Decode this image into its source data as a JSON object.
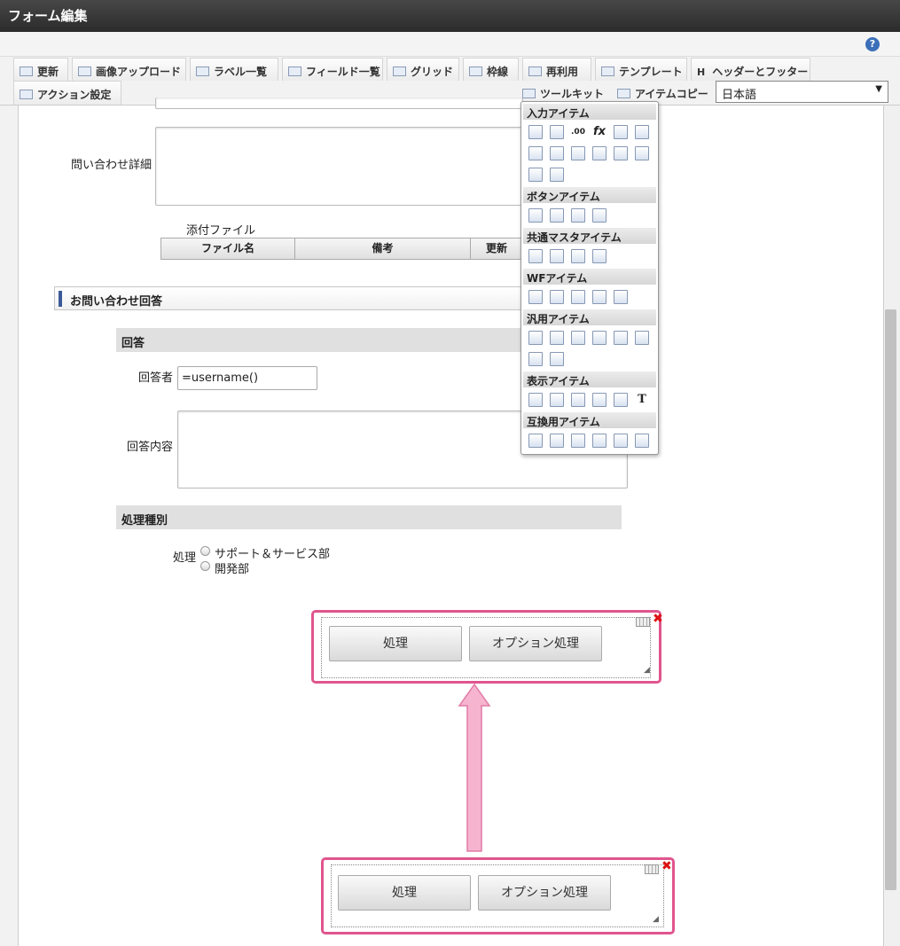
{
  "window": {
    "title": "フォーム編集"
  },
  "help": {
    "label": "?"
  },
  "toolbar": {
    "update": "更新",
    "image_upload": "画像アップロード",
    "label_list": "ラベル一覧",
    "field_list": "フィールド一覧",
    "grid": "グリッド",
    "border": "枠線",
    "reuse": "再利用",
    "template": "テンプレート",
    "header_footer": "ヘッダーとフッター",
    "action_settings": "アクション設定",
    "toolkit": "ツールキット",
    "item_copy": "アイテムコピー",
    "header_footer_glyph": "H"
  },
  "language": {
    "selected": "日本語",
    "arrow": "▼"
  },
  "form": {
    "inquiry_detail_label": "問い合わせ詳細",
    "attachment_label": "添付ファイル",
    "attachment_columns": [
      "ファイル名",
      "備考",
      "更新"
    ],
    "answer_section_title": "お問い合わせ回答",
    "answer_subhead": "回答",
    "answerer_label": "回答者",
    "answerer_value": "=username()",
    "answer_content_label": "回答内容",
    "process_type_subhead": "処理種別",
    "process_label": "処理",
    "process_options": [
      "サポート＆サービス部",
      "開発部"
    ]
  },
  "button_group": {
    "process": "処理",
    "option_process": "オプション処理",
    "remove_glyph": "✖",
    "resize_glyph": "◢"
  },
  "toolkit_panel": {
    "input_items": "入力アイテム",
    "button_items": "ボタンアイテム",
    "common_master_items": "共通マスタアイテム",
    "wf_items": "WFアイテム",
    "general_items": "汎用アイテム",
    "display_items": "表示アイテム",
    "compat_items": "互換用アイテム",
    "glyphs": {
      "number": ".00",
      "formula": "fx",
      "text": "T"
    }
  },
  "colors": {
    "highlight": "#e0558d",
    "arrow": "#f6b4cf",
    "titlebar": "#333333"
  }
}
